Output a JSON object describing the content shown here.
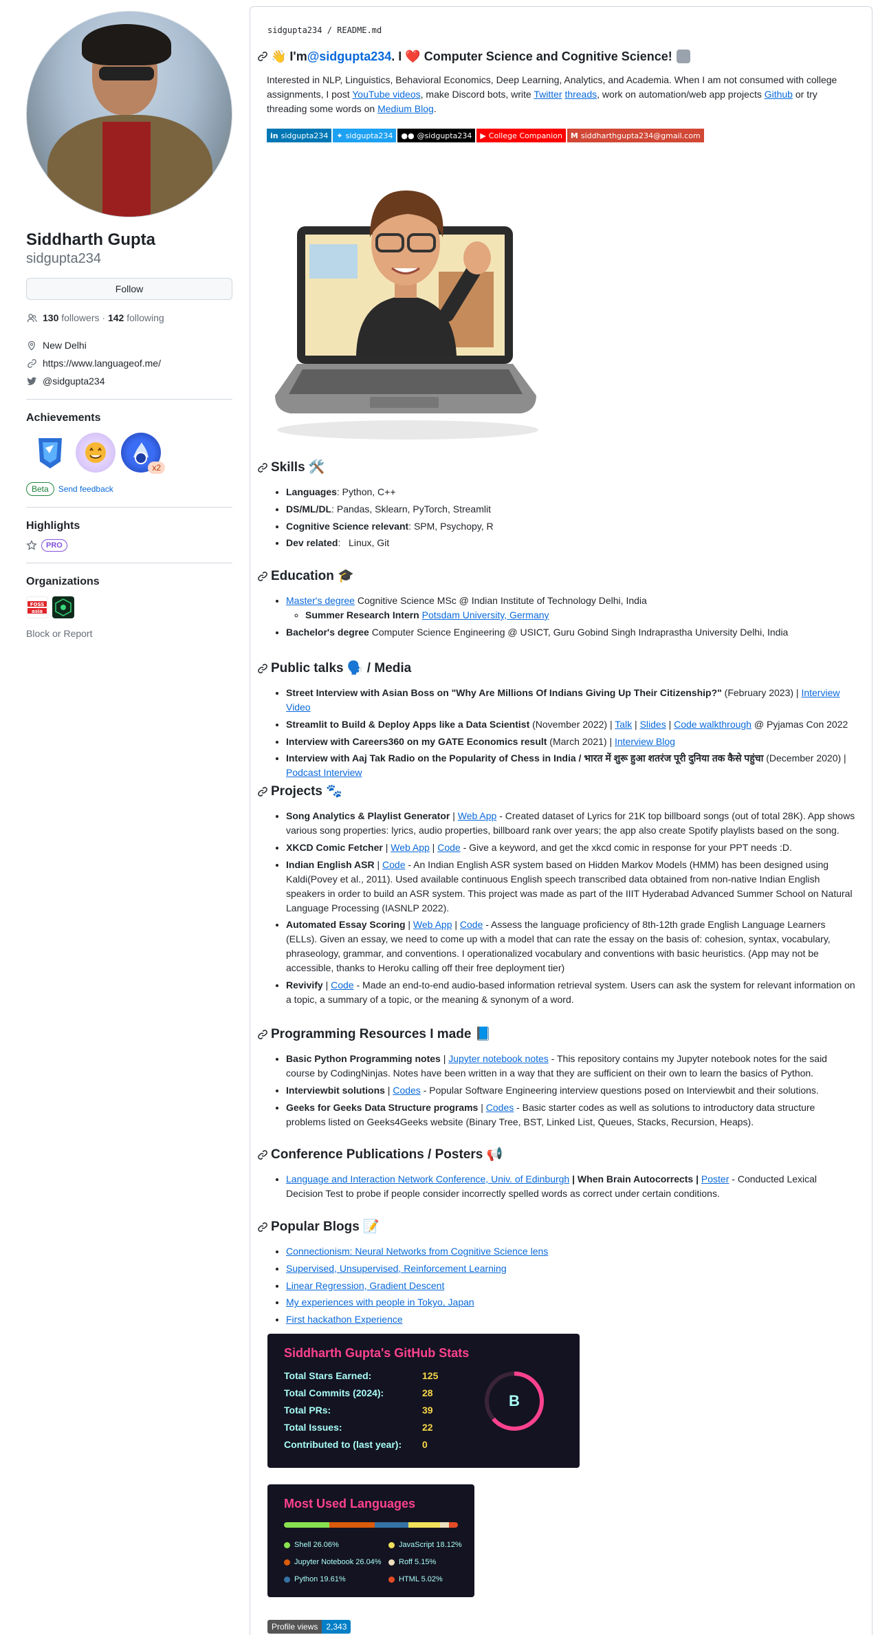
{
  "profile": {
    "name": "Siddharth Gupta",
    "login": "sidgupta234",
    "follow_label": "Follow",
    "followers_count": "130",
    "followers_label": "followers",
    "separator": "·",
    "following_count": "142",
    "following_label": "following",
    "location": "New Delhi",
    "website": "https://www.languageof.me/",
    "twitter": "@sidgupta234",
    "achievements_heading": "Achievements",
    "achievement_multiplier": "x2",
    "beta_label": "Beta",
    "feedback_label": "Send feedback",
    "highlights_heading": "Highlights",
    "pro_label": "PRO",
    "organizations_heading": "Organizations",
    "org1_label": "FOSS Asia",
    "block_report": "Block or Report"
  },
  "readme": {
    "path_user": "sidgupta234",
    "path_sep": " / ",
    "path_file": "README.md",
    "title_pre": "👋 I'm ",
    "title_link": "@sidgupta234",
    "title_post": ". I ❤️ Computer Science and Cognitive Science!",
    "intro_1": "Interested in NLP, Linguistics, Behavioral Economics, Deep Learning, Analytics, and Academia. When I am not consumed with college assignments, I post ",
    "intro_link1": "YouTube videos",
    "intro_2": ", make Discord bots, write ",
    "intro_link2": "Twitter",
    "intro_link3": "threads",
    "intro_3": ", work on automation/web app projects ",
    "intro_link4": "Github",
    "intro_4": " or try threading some words on ",
    "intro_link5": "Medium Blog",
    "intro_5": ".",
    "shields": [
      {
        "label": "sidgupta234",
        "color": "#0077b5",
        "icon": "in"
      },
      {
        "label": "sidgupta234",
        "color": "#1da1f2",
        "icon": "tw"
      },
      {
        "label": "@sidgupta234",
        "color": "#000000",
        "icon": "●●"
      },
      {
        "label": "College Companion",
        "color": "#ff0000",
        "icon": "▶"
      },
      {
        "label": "siddharthgupta234@gmail.com",
        "color": "#d14836",
        "icon": "M"
      }
    ],
    "skills_heading": "Skills 🛠️",
    "skills": [
      {
        "k": "Languages",
        "v": ": Python, C++"
      },
      {
        "k": "DS/ML/DL",
        "v": ": Pandas, Sklearn, PyTorch, Streamlit"
      },
      {
        "k": "Cognitive Science relevant",
        "v": ": SPM, Psychopy, R"
      },
      {
        "k": "Dev related",
        "v": ":   Linux, Git"
      }
    ],
    "education_heading": "Education 🎓",
    "edu_masters_link": "Master's degree",
    "edu_masters_text": " Cognitive Science MSc @ Indian Institute of Technology Delhi, India",
    "edu_intern_bold": "Summer Research Intern",
    "edu_intern_link": "Potsdam University, Germany",
    "edu_bachelors_bold": "Bachelor's degree",
    "edu_bachelors_text": " Computer Science Engineering @ USICT, Guru Gobind Singh Indraprastha University Delhi, India",
    "talks_heading": "Public talks 🗣️ / Media",
    "talk1_bold": "Street Interview with Asian Boss on \"Why Are Millions Of Indians Giving Up Their Citizenship?\"",
    "talk1_text": " (February 2023) | ",
    "talk1_link": "Interview Video",
    "talk2_bold": "Streamlit to Build & Deploy Apps like a Data Scientist",
    "talk2_text": " (November 2022) | ",
    "talk2_link1": "Talk",
    "talk2_link2": "Slides",
    "talk2_link3": "Code walkthrough",
    "talk2_tail": " @ Pyjamas Con 2022",
    "talk3_bold": "Interview with Careers360 on my GATE Economics result",
    "talk3_text": " (March 2021) | ",
    "talk3_link": "Interview Blog",
    "talk4_bold": "Interview with Aaj Tak Radio on the Popularity of Chess in India / भारत में शुरू हुआ शतरंज पूरी दुनिया तक कैसे पहुंचा",
    "talk4_text": " (December 2020) | ",
    "talk4_link": "Podcast Interview",
    "pipe": " | ",
    "projects_heading": "Projects 🐾",
    "proj1_bold": "Song Analytics & Playlist Generator",
    "proj1_link": "Web App",
    "proj1_text": " - Created dataset of Lyrics for 21K top billboard songs (out of total 28K). App shows various song properties: lyrics, audio properties, billboard rank over years; the app also create Spotify playlists based on the song.",
    "proj2_bold": "XKCD Comic Fetcher",
    "proj2_link1": "Web App",
    "proj2_link2": "Code",
    "proj2_text": " - Give a keyword, and get the xkcd comic in response for your PPT needs :D.",
    "proj3_bold": "Indian English ASR",
    "proj3_link": "Code",
    "proj3_text": " - An Indian English ASR system based on Hidden Markov Models (HMM) has been designed using Kaldi(Povey et al., 2011). Used available continuous English speech transcribed data obtained from non-native Indian English speakers in order to build an ASR system. This project was made as part of the IIIT Hyderabad Advanced Summer School on Natural Language Processing (IASNLP 2022).",
    "proj4_bold": "Automated Essay Scoring",
    "proj4_link1": "Web App",
    "proj4_link2": "Code",
    "proj4_text": " - Assess the language proficiency of 8th-12th grade English Language Learners (ELLs). Given an essay, we need to come up with a model that can rate the essay on the basis of: cohesion, syntax, vocabulary, phraseology, grammar, and conventions. I operationalized vocabulary and conventions with basic heuristics. (App may not be accessible, thanks to Heroku calling off their free deployment tier)",
    "proj5_bold": "Revivify",
    "proj5_link": "Code",
    "proj5_text": " - Made an end-to-end audio-based information retrieval system. Users can ask the system for relevant information on a topic, a summary of a topic, or the meaning & synonym of a word.",
    "resources_heading": "Programming Resources I made 📘",
    "res1_bold": "Basic Python Programming notes",
    "res1_link": "Jupyter notebook notes",
    "res1_text": " - This repository contains my Jupyter notebook notes for the said course by CodingNinjas. Notes have been written in a way that they are sufficient on their own to learn the basics of Python.",
    "res2_bold": "Interviewbit solutions",
    "res2_link": "Codes",
    "res2_text": " - Popular Software Engineering interview questions posed on Interviewbit and their solutions.",
    "res3_bold": "Geeks for Geeks Data Structure programs",
    "res3_link": "Codes",
    "res3_text": " - Basic starter codes as well as solutions to introductory data structure problems listed on Geeks4Geeks website (Binary Tree, BST, Linked List, Queues, Stacks, Recursion, Heaps).",
    "conf_heading": "Conference Publications / Posters 📢",
    "conf1_link": "Language and Interaction Network Conference, Univ. of Edinburgh",
    "conf1_bold": " | When Brain Autocorrects | ",
    "conf1_link2": "Poster",
    "conf1_text": " - Conducted Lexical Decision Test to probe if people consider incorrectly spelled words as correct under certain conditions.",
    "blogs_heading": "Popular Blogs 📝",
    "blogs": [
      "Connectionism: Neural Networks from Cognitive Science lens",
      "Supervised, Unsupervised, Reinforcement Learning",
      "Linear Regression, Gradient Descent",
      "My experiences with people in Tokyo, Japan",
      "First hackathon Experience"
    ]
  },
  "stats_card": {
    "title": "Siddharth Gupta's GitHub Stats",
    "rows": [
      {
        "label": "Total Stars Earned:",
        "value": "125"
      },
      {
        "label": "Total Commits (2024):",
        "value": "28"
      },
      {
        "label": "Total PRs:",
        "value": "39"
      },
      {
        "label": "Total Issues:",
        "value": "22"
      },
      {
        "label": "Contributed to (last year):",
        "value": "0"
      }
    ],
    "grade": "B"
  },
  "lang_card": {
    "title": "Most Used Languages",
    "langs": [
      {
        "name": "Shell 26.06%",
        "color": "#89e051",
        "pct": 26.06
      },
      {
        "name": "Jupyter Notebook 26.04%",
        "color": "#DA5B0B",
        "pct": 26.04
      },
      {
        "name": "Python 19.61%",
        "color": "#3572A5",
        "pct": 19.61
      },
      {
        "name": "JavaScript 18.12%",
        "color": "#f1e05a",
        "pct": 18.12
      },
      {
        "name": "Roff 5.15%",
        "color": "#ecdebe",
        "pct": 5.15
      },
      {
        "name": "HTML 5.02%",
        "color": "#e34c26",
        "pct": 5.02
      }
    ]
  },
  "views_badge": {
    "label": "Profile views",
    "value": "2,343",
    "color": "#007ec6"
  }
}
